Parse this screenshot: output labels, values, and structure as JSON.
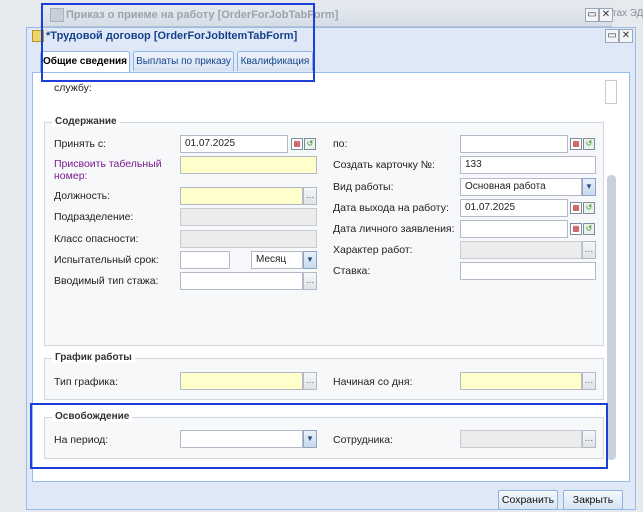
{
  "background_window": {
    "title": "Приказ о приеме на работу [OrderForJobTabForm]",
    "side_text": "тах ЭДО",
    "minimize_glyph": "▭",
    "close_glyph": "✕"
  },
  "window": {
    "title": "*Трудовой договор [OrderForJobItemTabForm]",
    "minimize_glyph": "▭",
    "close_glyph": "✕"
  },
  "tabs": [
    {
      "label": "Общие сведения",
      "active": true
    },
    {
      "label": "Выплаты по приказу",
      "active": false
    },
    {
      "label": "Квалификация",
      "active": false
    }
  ],
  "top_fragment": {
    "label": "службу:"
  },
  "content_section": {
    "legend": "Содержание",
    "left": {
      "accept_from_label": "Принять с:",
      "accept_from_value": "01.07.2025",
      "tab_number_label_1": "Присвоить табельный",
      "tab_number_label_2": "номер:",
      "position_label": "Должность:",
      "department_label": "Подразделение:",
      "hazard_class_label": "Класс опасности:",
      "probation_label": "Испытательный срок:",
      "probation_value": "",
      "probation_unit": "Месяц",
      "seniority_label": "Вводимый тип стажа:"
    },
    "right": {
      "to_label": "по:",
      "to_value": "",
      "card_label": "Создать карточку №:",
      "card_value": "133",
      "work_type_label": "Вид работы:",
      "work_type_value": "Основная работа",
      "start_date_label": "Дата выхода на работу:",
      "start_date_value": "01.07.2025",
      "application_date_label": "Дата личного заявления:",
      "work_nature_label": "Характер работ:",
      "rate_label": "Ставка:"
    }
  },
  "schedule_section": {
    "legend": "График работы",
    "schedule_type_label": "Тип графика:",
    "start_day_label": "Начиная со дня:"
  },
  "release_section": {
    "legend": "Освобождение",
    "period_label": "На период:",
    "employee_label": "Сотрудника:"
  },
  "icons": {
    "ellipsis": "…",
    "dropdown": "▼",
    "calendar": "▦",
    "clear": "↺"
  },
  "buttons": {
    "save": "Сохранить",
    "close": "Закрыть"
  }
}
